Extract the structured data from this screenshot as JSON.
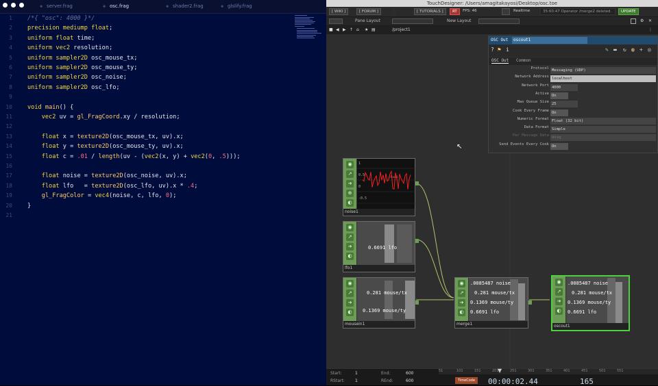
{
  "editor": {
    "tabs": [
      "server.frag",
      "osc.frag",
      "shader2.frag",
      "glslify.frag"
    ],
    "line_numbers": [
      "1",
      "2",
      "3",
      "4",
      "5",
      "6",
      "7",
      "8",
      "9",
      "10",
      "11",
      "12",
      "13",
      "14",
      "15",
      "16",
      "17",
      "18",
      "19",
      "20",
      "21"
    ]
  },
  "app": {
    "title": "TouchDesigner: /Users/amagitakayosi/Desktop/osc.toe",
    "wiki": "[ WIKI ]",
    "forum": "[ FORUM ]",
    "tutorials": "[ TUTORIALS ]",
    "mode": "RT",
    "fps": "FPS: 46",
    "realtime": "Realtime",
    "status": "35:60:47 Operator /merge2 deleted.",
    "update": "UPDATE",
    "pane_layout": "Pane Layout",
    "new_layout": "New Layout",
    "path": "/project1"
  },
  "params": {
    "op_type": "OSC Out",
    "op_name": "oscout1",
    "tab_active": "OSC Out",
    "tab_common": "Common",
    "rows": [
      {
        "label": "Protocol",
        "value": "Messaging (UDP)"
      },
      {
        "label": "Network Address",
        "value": "localhost"
      },
      {
        "label": "Network Port",
        "value": "4000"
      },
      {
        "label": "Active",
        "value": "On"
      },
      {
        "label": "Max Queue Size",
        "value": "25"
      },
      {
        "label": "Cook Every Frame",
        "value": "On"
      },
      {
        "label": "Numeric Format",
        "value": "Float (32 bit)"
      },
      {
        "label": "Data Format",
        "value": "Simple"
      },
      {
        "label": "Per Message Data",
        "value": "Uniq"
      },
      {
        "label": "Send Events Every Cook",
        "value": "On"
      }
    ]
  },
  "nodes": {
    "noise1": {
      "name": "noise1",
      "ticks": [
        "1",
        "0.5",
        "0",
        "-0.5"
      ],
      "legend": "chan1"
    },
    "lfo1": {
      "name": "lfo1",
      "value": "0.6691 lfo"
    },
    "mousein1": {
      "name": "mousein1",
      "row1": "0.281 mouse/tx",
      "row2": "0.1369 mouse/ty"
    },
    "merge1": {
      "name": "merge1",
      "rows": [
        ".0085487 noise",
        "0.281 mouse/tx",
        "0.1369 mouse/ty",
        "0.6691 lfo"
      ]
    },
    "oscout1": {
      "name": "oscout1",
      "rows": [
        ".0085487 noise",
        "0.281 mouse/tx",
        "0.1369 mouse/ty",
        "0.6691 lfo"
      ]
    }
  },
  "timeline": {
    "start_label": "Start:",
    "start": "1",
    "end_label": "End:",
    "end": "600",
    "rstart_label": "RStart:",
    "rstart": "1",
    "rend_label": "REnd:",
    "rend": "600",
    "ruler": [
      "51",
      "101",
      "151",
      "201",
      "251",
      "301",
      "351",
      "401",
      "451",
      "501",
      "551"
    ],
    "timecode_label": "TimeCode",
    "timecode": "00:00:02.44",
    "frame": "165"
  },
  "colors": {
    "accent": "#6d9c56",
    "selected": "#4cd23c",
    "editor_bg": "#000d3c"
  }
}
